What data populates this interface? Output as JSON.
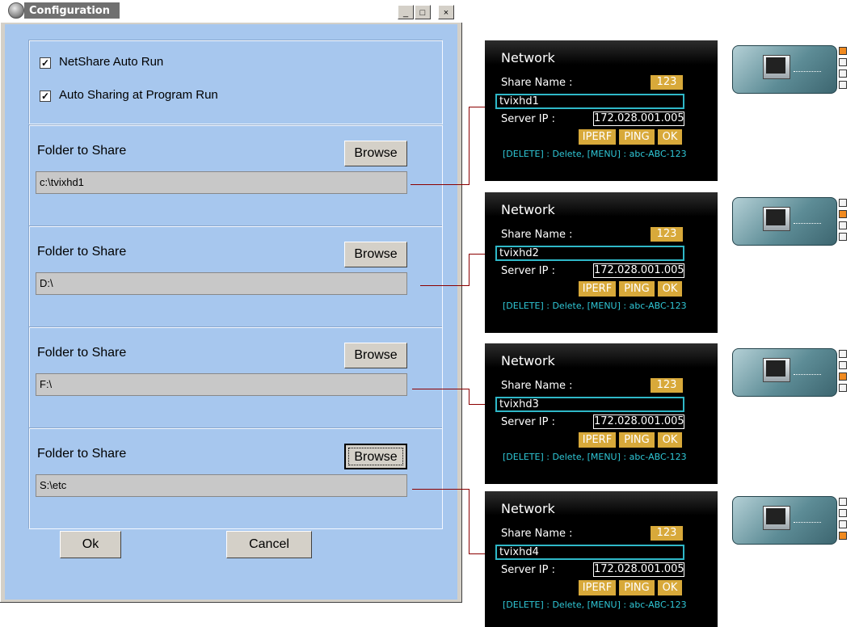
{
  "window": {
    "title": "Configuration",
    "min_glyph": "_",
    "max_glyph": "□",
    "close_glyph": "×"
  },
  "options": {
    "autorun_label": "NetShare  Auto Run",
    "autorun_checked": true,
    "autoshare_label": "Auto Sharing at Program Run",
    "autoshare_checked": true,
    "check_glyph": "✓"
  },
  "shares": [
    {
      "label": "Folder to Share",
      "browse": "Browse",
      "path": "c:\\tvixhd1"
    },
    {
      "label": "Folder to Share",
      "browse": "Browse",
      "path": "D:\\"
    },
    {
      "label": "Folder to Share",
      "browse": "Browse",
      "path": "F:\\"
    },
    {
      "label": "Folder to Share",
      "browse": "Browse",
      "path": "S:\\etc"
    }
  ],
  "buttons": {
    "ok": "Ok",
    "cancel": "Cancel"
  },
  "network_panels": [
    {
      "title": "Network",
      "share_name_label": "Share Name :",
      "badge": "123",
      "share_name": "tvixhd1",
      "server_ip_label": "Server IP :",
      "server_ip": "172.028.001.005",
      "iperf": "IPERF",
      "ping": "PING",
      "ok": "OK",
      "help": "[DELETE] : Delete, [MENU] : abc-ABC-123"
    },
    {
      "title": "Network",
      "share_name_label": "Share Name :",
      "badge": "123",
      "share_name": "tvixhd2",
      "server_ip_label": "Server IP :",
      "server_ip": "172.028.001.005",
      "iperf": "IPERF",
      "ping": "PING",
      "ok": "OK",
      "help": "[DELETE] : Delete, [MENU] : abc-ABC-123"
    },
    {
      "title": "Network",
      "share_name_label": "Share Name :",
      "badge": "123",
      "share_name": "tvixhd3",
      "server_ip_label": "Server IP :",
      "server_ip": "172.028.001.005",
      "iperf": "IPERF",
      "ping": "PING",
      "ok": "OK",
      "help": "[DELETE] : Delete, [MENU] : abc-ABC-123"
    },
    {
      "title": "Network",
      "share_name_label": "Share Name :",
      "badge": "123",
      "share_name": "tvixhd4",
      "server_ip_label": "Server IP :",
      "server_ip": "172.028.001.005",
      "iperf": "IPERF",
      "ping": "PING",
      "ok": "OK",
      "help": "[DELETE] : Delete, [MENU] : abc-ABC-123"
    }
  ],
  "thumbnails": [
    {
      "active_slot": 1
    },
    {
      "active_slot": 2
    },
    {
      "active_slot": 3
    },
    {
      "active_slot": 4
    }
  ],
  "colors": {
    "window_client": "#a7c7ee",
    "connector": "#8b0000",
    "osd_highlight": "#d8a93a",
    "osd_cyan": "#2fb8c8"
  }
}
